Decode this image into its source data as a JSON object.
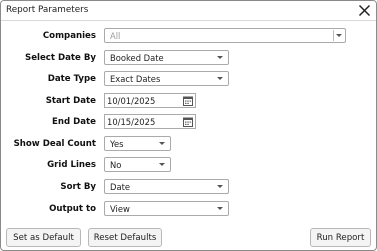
{
  "dialog": {
    "title": "Report Parameters"
  },
  "fields": {
    "companies": {
      "label": "Companies",
      "value": "All"
    },
    "select_date_by": {
      "label": "Select Date By",
      "value": "Booked Date"
    },
    "date_type": {
      "label": "Date Type",
      "value": "Exact Dates"
    },
    "start_date": {
      "label": "Start Date",
      "value": "10/01/2025"
    },
    "end_date": {
      "label": "End Date",
      "value": "10/15/2025"
    },
    "show_deal_count": {
      "label": "Show Deal Count",
      "value": "Yes"
    },
    "grid_lines": {
      "label": "Grid Lines",
      "value": "No"
    },
    "sort_by": {
      "label": "Sort By",
      "value": "Date"
    },
    "output_to": {
      "label": "Output to",
      "value": "View"
    }
  },
  "buttons": {
    "set_as_default": "Set as Default",
    "reset_defaults": "Reset Defaults",
    "run_report": "Run Report"
  },
  "icons": {
    "close": "close-icon",
    "calendar": "calendar-icon",
    "dropdown": "chevron-down-icon"
  }
}
